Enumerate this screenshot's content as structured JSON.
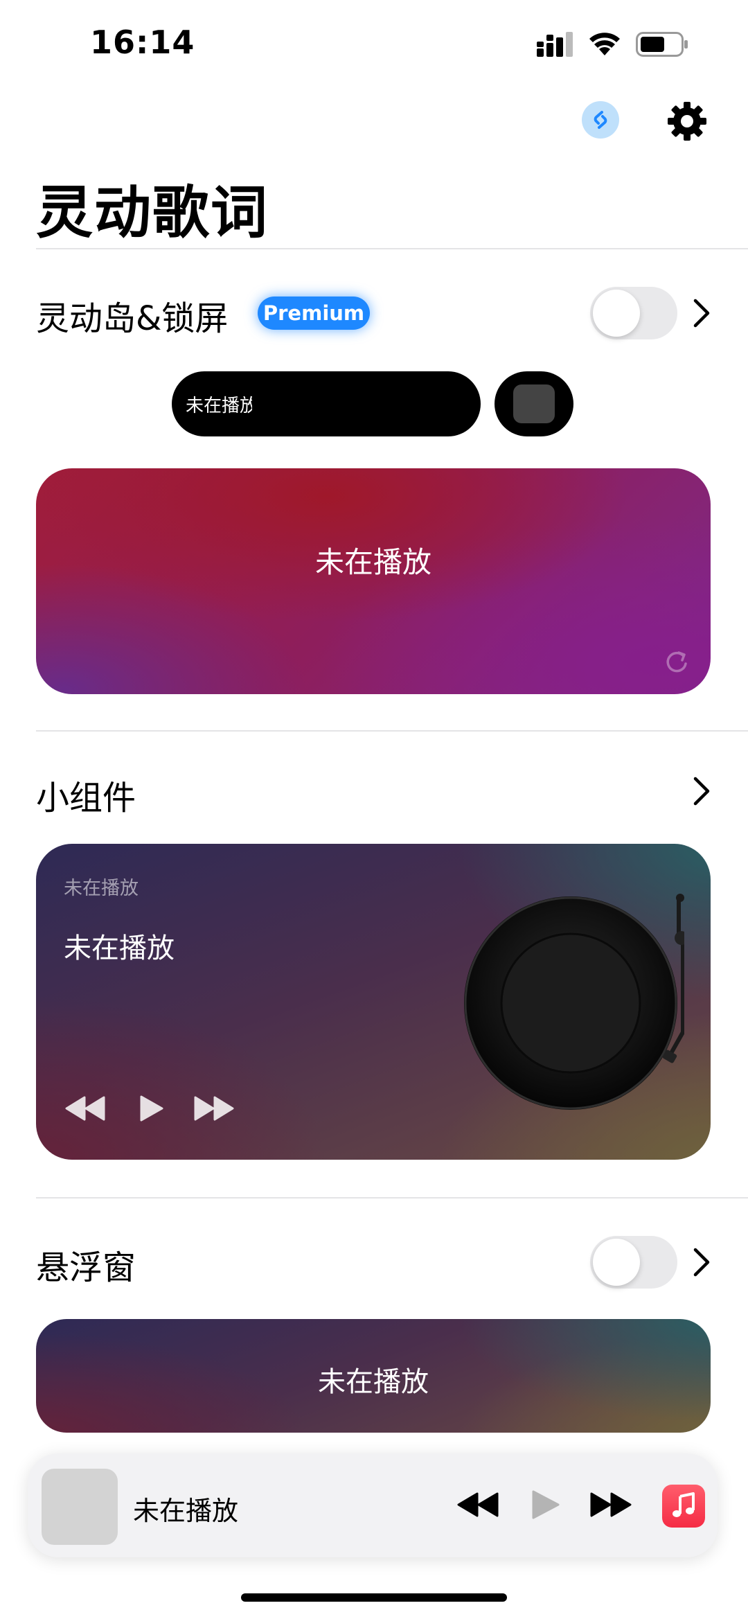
{
  "status_bar": {
    "time": "16:14",
    "icons": [
      "signal-icon",
      "wifi-icon",
      "battery-icon"
    ]
  },
  "header": {
    "actions": [
      "shazam-icon",
      "gear-icon"
    ],
    "title": "灵动歌词"
  },
  "sections": {
    "island": {
      "title": "灵动岛&锁屏",
      "badge": "Premium",
      "toggle_on": false,
      "pill_text": "未在播放",
      "card_text": "未在播放"
    },
    "widget": {
      "title": "小组件",
      "small_text": "未在播放",
      "track_text": "未在播放",
      "controls": [
        "rewind-icon",
        "play-icon",
        "fast-forward-icon"
      ]
    },
    "floating": {
      "title": "悬浮窗",
      "toggle_on": false,
      "card_text": "未在播放"
    }
  },
  "mini_player": {
    "title": "未在播放",
    "controls": [
      "rewind-icon",
      "play-icon",
      "fast-forward-icon"
    ],
    "app_icon": "music-note-icon"
  },
  "colors": {
    "accent": "#1e88ff",
    "music_red": "#f52c45"
  }
}
